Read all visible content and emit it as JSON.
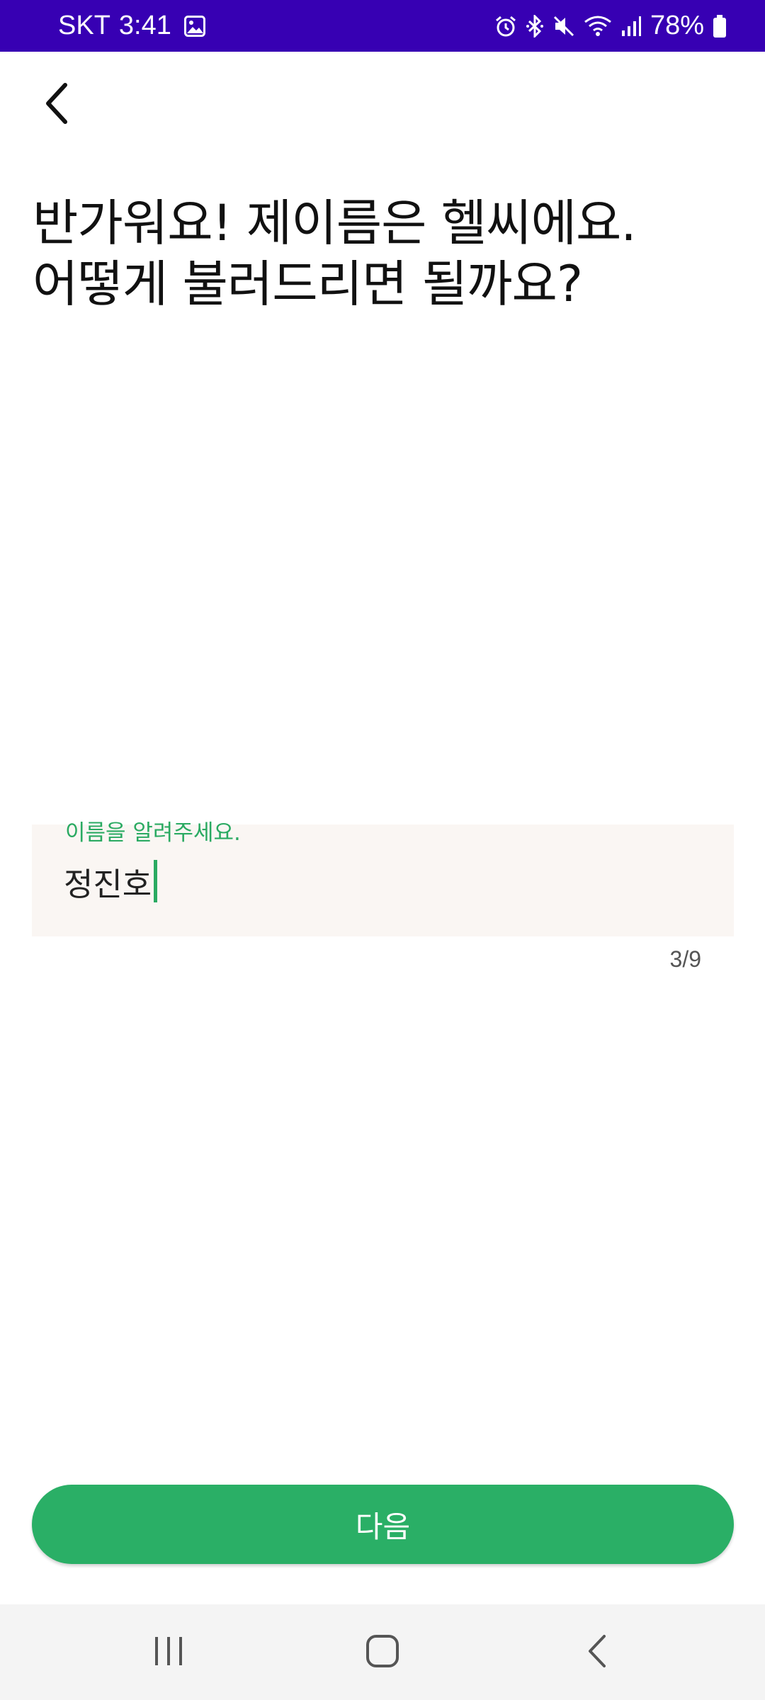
{
  "status_bar": {
    "carrier": "SKT",
    "time": "3:41",
    "battery": "78%",
    "icons": [
      "gallery-icon",
      "alarm-icon",
      "bluetooth-icon",
      "mute-icon",
      "wifi-icon",
      "signal-icon",
      "battery-icon"
    ],
    "background_color": "#3700b3"
  },
  "header": {
    "back_icon": "back-arrow-icon"
  },
  "main": {
    "heading_line1": "반가워요! 제이름은 헬씨에요.",
    "heading_line2": "어떻게 불러드리면 될까요?",
    "name_field": {
      "label": "이름을 알려주세요.",
      "value": "정진호",
      "counter": "3/9"
    },
    "next_button": {
      "label": "다음"
    }
  },
  "theme": {
    "accent": "#2aaf66",
    "field_background": "#faf6f3"
  },
  "nav_bar": {
    "buttons": [
      "recents-icon",
      "home-icon",
      "back-icon"
    ]
  }
}
